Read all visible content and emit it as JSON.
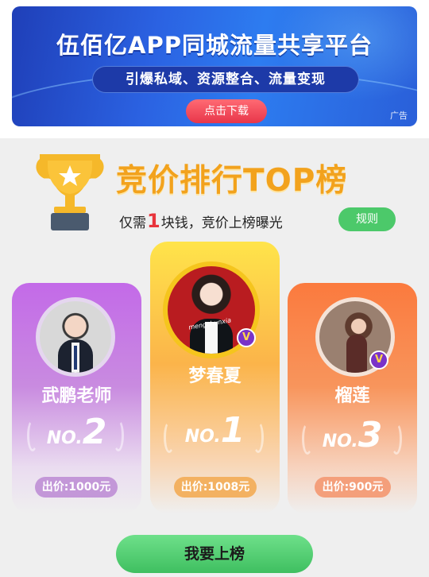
{
  "ad": {
    "title": "伍佰亿APP同城流量共享平台",
    "subtitle": "引爆私域、资源整合、流量变现",
    "download_label": "点击下载",
    "ad_label": "广告"
  },
  "ranking": {
    "title": "竞价排行TOP榜",
    "subtitle_prefix": "仅需",
    "subtitle_amount": "1",
    "subtitle_suffix": "块钱，竞价上榜曝光",
    "rules_label": "规则"
  },
  "leaders": [
    {
      "rank_label": "NO.",
      "rank": "1",
      "name": "梦春夏",
      "bid": "出价:1008元",
      "avatar_text": "mengchunxia"
    },
    {
      "rank_label": "NO.",
      "rank": "2",
      "name": "武鹏老师",
      "bid": "出价:1000元"
    },
    {
      "rank_label": "NO.",
      "rank": "3",
      "name": "榴莲",
      "bid": "出价:900元"
    }
  ],
  "cta_label": "我要上榜",
  "colors": {
    "banner_blue": "#2b62e2",
    "gold_title": "#f2a21d",
    "rank1": "#fbb44a",
    "rank2": "#c36ae8",
    "rank3": "#fb7a3e",
    "cta_green": "#4cc96a",
    "vip_badge": "#7a33c8"
  },
  "icons": {
    "trophy": "trophy-icon",
    "vip": "vip-badge-icon"
  }
}
